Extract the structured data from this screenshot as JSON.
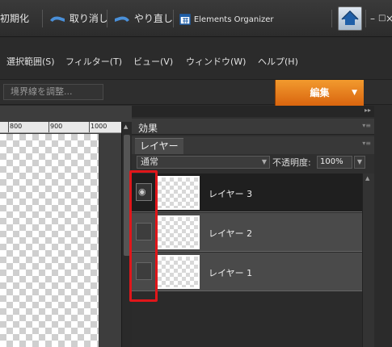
{
  "toolbar": {
    "reset": "初期化",
    "undo": "取り消し",
    "redo": "やり直し",
    "organizer": "Elements Organizer",
    "minimize": "–",
    "restore": "□",
    "close": "×"
  },
  "menu": {
    "items": [
      "選択範囲(S)",
      "フィルター(T)",
      "ビュー(V)",
      "ウィンドウ(W)",
      "ヘルプ(H)"
    ]
  },
  "options": {
    "adjust_edge": "境界線を調整...",
    "edit_button": "編集",
    "edit_caret": "▼"
  },
  "ruler": {
    "ticks": [
      "800",
      "900",
      "1000"
    ]
  },
  "panel": {
    "effects_tab": "効果",
    "layers_tab": "レイヤー",
    "blend_mode": "通常",
    "opacity_label": "不透明度:",
    "opacity_value": "100%",
    "menu_icon": "▾≡",
    "strip_more": "▸▸",
    "dd_arrow": "▼",
    "eye_glyph": "◉",
    "scroll_up": "▲"
  },
  "layers": [
    {
      "name": "レイヤー 3",
      "visible": true,
      "active": true
    },
    {
      "name": "レイヤー 2",
      "visible": false,
      "active": false
    },
    {
      "name": "レイヤー 1",
      "visible": false,
      "active": false
    }
  ],
  "colors": {
    "accent_orange": "#e87a1c",
    "highlight_red": "#e0161a",
    "home_blue": "#1f5fa8"
  }
}
